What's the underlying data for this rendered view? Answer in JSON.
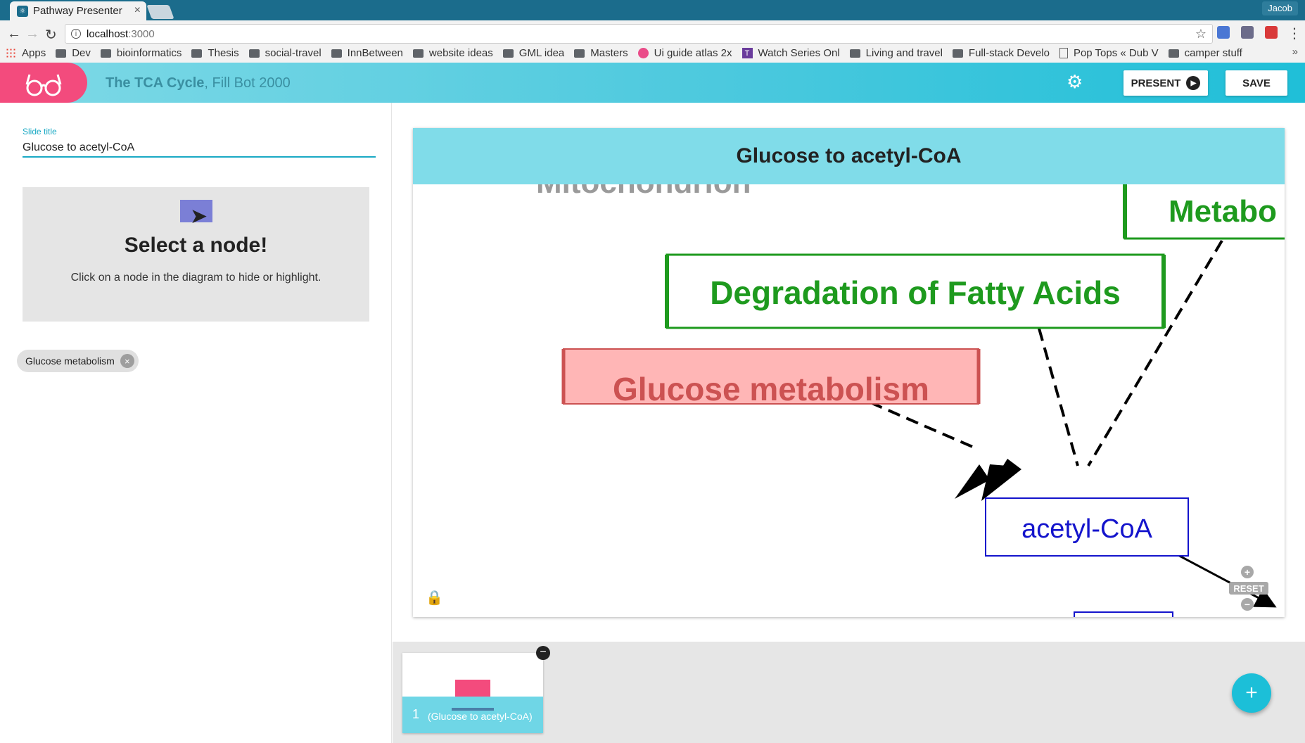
{
  "browser": {
    "tab_title": "Pathway Presenter",
    "tab_close": "×",
    "profile_name": "Jacob",
    "url_host": "localhost",
    "url_port": ":3000",
    "bookmarks": [
      {
        "label": "Apps",
        "icon": "apps-icon"
      },
      {
        "label": "Dev",
        "icon": "folder-icon"
      },
      {
        "label": "bioinformatics",
        "icon": "folder-icon"
      },
      {
        "label": "Thesis",
        "icon": "folder-icon"
      },
      {
        "label": "social-travel",
        "icon": "folder-icon"
      },
      {
        "label": "InnBetween",
        "icon": "folder-icon"
      },
      {
        "label": "website ideas",
        "icon": "folder-icon"
      },
      {
        "label": "GML idea",
        "icon": "folder-icon"
      },
      {
        "label": "Masters",
        "icon": "folder-icon"
      },
      {
        "label": "Ui guide atlas 2x",
        "icon": "dribbble-icon"
      },
      {
        "label": "Watch Series Onl",
        "icon": "t-icon"
      },
      {
        "label": "Living and travel",
        "icon": "car-icon"
      },
      {
        "label": "Full-stack Develo",
        "icon": "grid-icon"
      },
      {
        "label": "Pop Tops « Dub V",
        "icon": "doc-icon"
      },
      {
        "label": "camper stuff",
        "icon": "folder-icon"
      }
    ],
    "bookmarks_more": "»"
  },
  "app": {
    "title_bold": "The TCA Cycle",
    "title_rest": ", Fill Bot 2000",
    "present_label": "PRESENT",
    "save_label": "SAVE"
  },
  "editor": {
    "slide_title_label": "Slide title",
    "slide_title_value": "Glucose to acetyl-CoA",
    "select_title": "Select a node!",
    "select_text": "Click on a node in the diagram to hide or highlight.",
    "chip_label": "Glucose metabolism",
    "chip_remove": "×"
  },
  "diagram": {
    "header": "Glucose to acetyl-CoA",
    "nodes": {
      "mitochondrion": "Mitochondrion",
      "metabolism_partial": "Metabo",
      "fatty_acids": "Degradation of Fatty Acids",
      "glucose": "Glucose metabolism",
      "acetyl_coa": "acetyl-CoA"
    },
    "zoom_in": "+",
    "zoom_reset": "RESET",
    "zoom_out": "−",
    "colors": {
      "header_bg": "#80dce9",
      "pathway_green": "#1e9a1e",
      "highlight_red_bg": "#ffb6b6",
      "highlight_red_text": "#cc5252",
      "metabolite_blue": "#1414cc"
    }
  },
  "slides": [
    {
      "number": "1",
      "label": "(Glucose to acetyl-CoA)"
    }
  ],
  "slides_remove": "−",
  "fab_label": "+"
}
